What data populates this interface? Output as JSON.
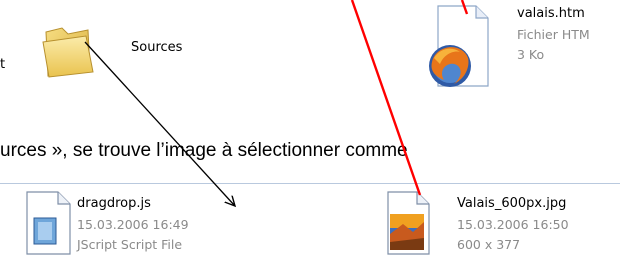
{
  "top_folder": {
    "fragment": "t",
    "folder_label": "Sources",
    "file_name": "valais.htm",
    "file_type": "Fichier HTM",
    "file_size": "3 Ko"
  },
  "caption": {
    "text": "urces », se trouve l’image à sélectionner comme"
  },
  "bottom_folder": {
    "items": [
      {
        "name": "dragdrop.js",
        "date": "15.03.2006 16:49",
        "type": "JScript Script File"
      },
      {
        "name": "Valais_600px.jpg",
        "date": "15.03.2006 16:50",
        "dims": "600 x 377"
      }
    ]
  },
  "colors": {
    "arrow_black": "#000000",
    "arrow_red": "#ff0000",
    "folder_yellow": "#f3d86a"
  }
}
